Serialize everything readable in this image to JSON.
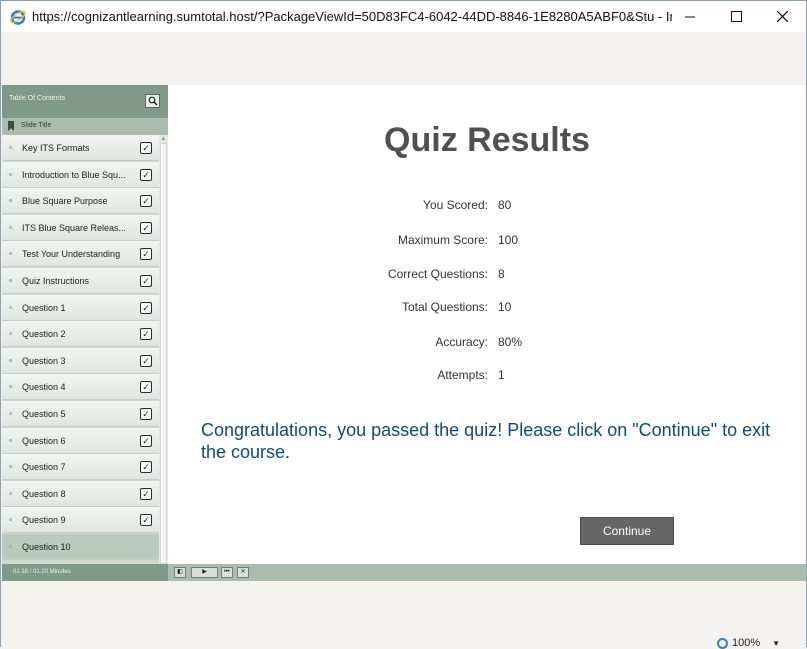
{
  "window": {
    "title": "https://cognizantlearning.sumtotal.host/?PackageViewId=50D83FC4-6042-44DD-8846-1E8280A5ABF0&Stu - Internet Ex...",
    "minimize_icon": "minimize-icon",
    "maximize_icon": "maximize-icon",
    "close_icon": "close-icon"
  },
  "sidebar": {
    "header": "Table Of Contents",
    "column_title": "Slide Title",
    "items": [
      {
        "label": "Key ITS Formats",
        "checked": true
      },
      {
        "label": "Introduction to Blue Squ...",
        "checked": true
      },
      {
        "label": "Blue Square Purpose",
        "checked": true
      },
      {
        "label": "ITS Blue Square Releas...",
        "checked": true
      },
      {
        "label": "Test Your Understanding",
        "checked": true
      },
      {
        "label": "Quiz Instructions",
        "checked": true
      },
      {
        "label": "Question 1",
        "checked": true
      },
      {
        "label": "Question 2",
        "checked": true
      },
      {
        "label": "Question 3",
        "checked": true
      },
      {
        "label": "Question 4",
        "checked": true
      },
      {
        "label": "Question 5",
        "checked": true
      },
      {
        "label": "Question 6",
        "checked": true
      },
      {
        "label": "Question 7",
        "checked": true
      },
      {
        "label": "Question 8",
        "checked": true
      },
      {
        "label": "Question 9",
        "checked": true
      },
      {
        "label": "Question 10",
        "checked": false
      }
    ],
    "active_item": "Question 10"
  },
  "content": {
    "title": "Quiz Results",
    "results": [
      {
        "label": "You Scored:",
        "value": "80"
      },
      {
        "label": "Maximum Score:",
        "value": "100"
      },
      {
        "label": "Correct Questions:",
        "value": "8"
      },
      {
        "label": "Total Questions:",
        "value": "10"
      },
      {
        "label": "Accuracy:",
        "value": "80%"
      },
      {
        "label": "Attempts:",
        "value": "1"
      }
    ],
    "message": "Congratulations, you passed the quiz! Please click on \"Continue\" to exit the course.",
    "continue_label": "Continue"
  },
  "controls": {
    "time": "01:18 / 01:20 Minutes",
    "buttons": [
      "toc-toggle-icon",
      "play-icon",
      "rewind-icon",
      "close-icon"
    ]
  },
  "status": {
    "zoom": "100%"
  },
  "colors": {
    "message": "#0b4d77",
    "toc_header": "#7f9a88",
    "control_bar": "#a9bcae",
    "continue_button": "#666666"
  }
}
